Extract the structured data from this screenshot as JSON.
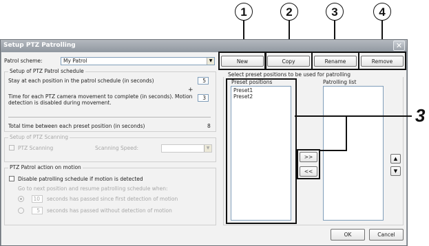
{
  "callouts": {
    "c1": "1",
    "c2": "2",
    "c3": "3",
    "c4": "4",
    "side": "3"
  },
  "window": {
    "title": "Setup PTZ Patrolling",
    "close_glyph": "✕"
  },
  "scheme": {
    "label": "Patrol scheme:",
    "value": "My Patrol"
  },
  "top_buttons": {
    "new": "New",
    "copy": "Copy",
    "rename": "Rename",
    "remove": "Remove"
  },
  "schedule": {
    "title": "Setup of PTZ Patrol schedule",
    "stay_label": "Stay at each position in the patrol schedule (in seconds)",
    "stay_value": "5",
    "move_label_1": "Time for each PTZ camera movement to complete (in seconds). Motion",
    "move_label_2": "detection is disabled during movement.",
    "move_value": "3",
    "plus": "+",
    "total_label": "Total time between each preset position (in seconds)",
    "total_value": "8"
  },
  "scanning": {
    "title": "Setup of PTZ Scanning",
    "checkbox_label": "PTZ Scanning",
    "speed_label": "Scanning Speed:"
  },
  "motion": {
    "title": "PTZ Patrol action on motion",
    "disable_label": "Disable patrolling schedule if motion is detected",
    "resume_label": "Go to next position and resume patrolling schedule when:",
    "opt1_value": "10",
    "opt1_label": "seconds has passed since first detection of motion",
    "opt2_value": "5",
    "opt2_label": "seconds has passed without detection of motion"
  },
  "presets": {
    "instruction": "Select preset positions to be used for patrolling",
    "presets_label": "Preset positions",
    "items": [
      "Preset1",
      "Preset2"
    ],
    "patrolling_label": "Patrolling list",
    "add": ">>",
    "remove": "<<",
    "up": "▲",
    "down": "▼"
  },
  "footer": {
    "ok": "OK",
    "cancel": "Cancel"
  }
}
